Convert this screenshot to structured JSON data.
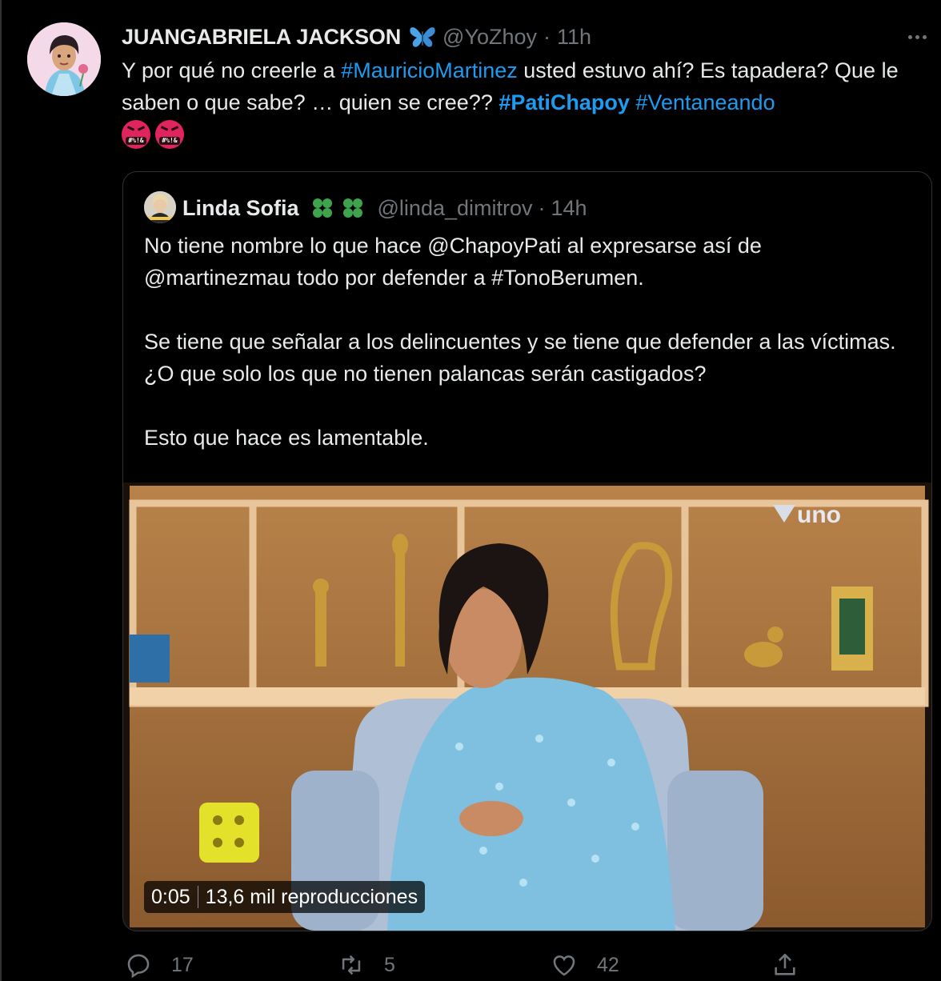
{
  "tweet": {
    "display_name": "JUANGABRIELA JACKSON",
    "handle": "@YoZhoy",
    "separator": "·",
    "time": "11h",
    "text": {
      "part1": "Y por qué no creerle a ",
      "hashtag1": "#MauricioMartinez",
      "part2": " usted estuvo ahí? Es tapadera? Que le saben o que sabe? … quien se cree?? ",
      "hashtag2": "#PatiChapoy",
      "part3": " ",
      "hashtag3": "#Ventaneando"
    },
    "emoji_symbol": "#%!&"
  },
  "quoted_tweet": {
    "display_name": "Linda Sofia",
    "handle": "@linda_dimitrov",
    "separator": "·",
    "time": "14h",
    "text": "No tiene nombre lo que hace @ChapoyPati al expresarse así de @martinezmau todo por defender a #TonoBerumen.\n\nSe tiene que señalar a los delincuentes y se tiene que defender a las víctimas. ¿O que solo los que no tienen palancas serán castigados?\n\nEsto que hace es lamentable.",
    "video": {
      "duration": "0:05",
      "views": "13,6 mil reproducciones",
      "channel_logo": "uno"
    }
  },
  "actions": {
    "reply_count": "17",
    "retweet_count": "5",
    "like_count": "42"
  },
  "colors": {
    "background": "#000000",
    "text": "#e7e9ea",
    "muted": "#71767b",
    "link": "#1d9bf0",
    "border": "#2f3336"
  }
}
